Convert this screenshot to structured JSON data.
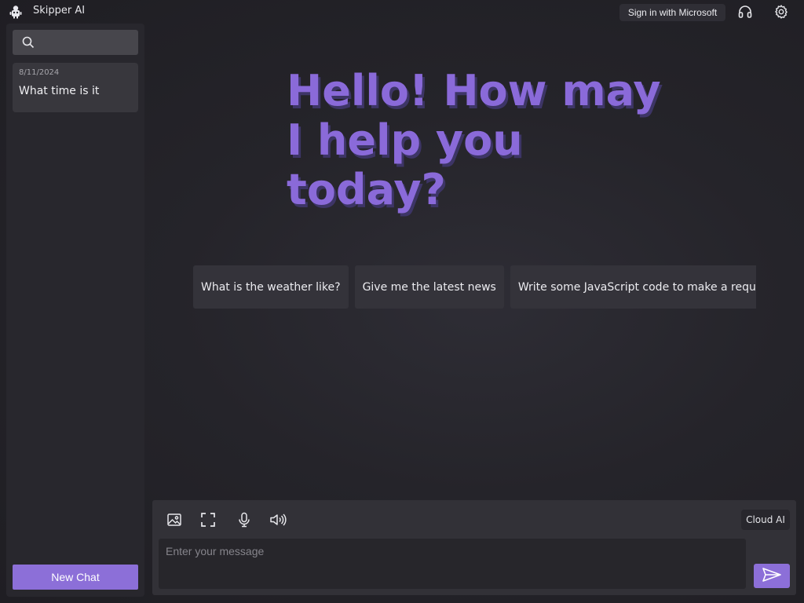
{
  "app": {
    "title": "Skipper AI",
    "icon": "robot-icon"
  },
  "topbar": {
    "sign_in_label": "Sign in with Microsoft",
    "icons": [
      "headset-icon",
      "gear-icon"
    ]
  },
  "sidebar": {
    "search": {
      "placeholder": "",
      "value": "",
      "icon": "search-icon"
    },
    "chats": [
      {
        "date": "8/11/2024",
        "title": "What time is it"
      }
    ],
    "new_chat_label": "New Chat"
  },
  "main": {
    "greeting_lines": [
      "Hello! How may",
      "I help you",
      "today?"
    ],
    "suggestions": [
      "What is the weather like?",
      "Give me the latest news",
      "Write some JavaScript code to make a requ"
    ]
  },
  "composer": {
    "tools": [
      "image-icon",
      "screenshot-icon",
      "microphone-icon",
      "speaker-icon"
    ],
    "mode_label": "Cloud AI",
    "input_placeholder": "Enter your message",
    "input_value": "",
    "send_icon": "send-icon"
  },
  "colors": {
    "accent": "#8c6fd8",
    "greeting": "#8a6ad9",
    "background": "#25242a",
    "sidebar": "#28272d"
  }
}
